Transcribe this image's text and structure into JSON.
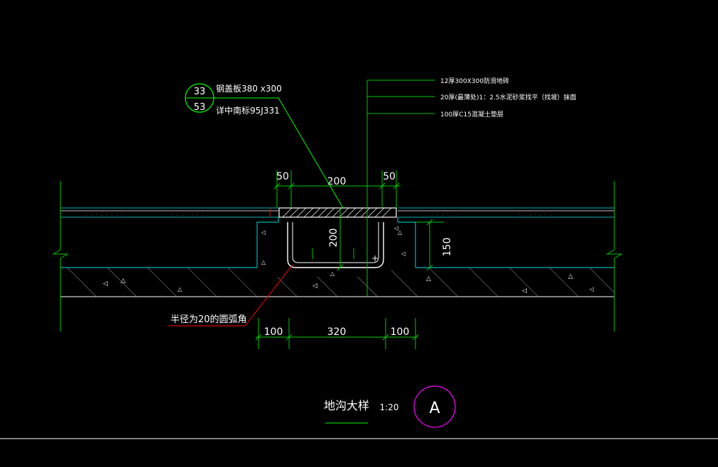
{
  "drawing": {
    "title": "地沟大样",
    "scale": "1:20",
    "detail_mark": "A",
    "callout": {
      "index_top": "33",
      "index_bottom": "53",
      "line1": "钢盖板380 x300",
      "line2": "详中南标95J331"
    },
    "layers": [
      "12厚300X300防滑地砖",
      "20厚(最薄处)1：2.5水泥砂浆找平（找坡）抹面",
      "100厚C15混凝土垫层"
    ],
    "radius_note": "半径为20的圆弧角",
    "dims": {
      "top_left": "50",
      "top_mid": "200",
      "top_right": "50",
      "bottom_left": "100",
      "bottom_mid": "320",
      "bottom_right": "100",
      "trench_depth": "200",
      "right_height": "150"
    },
    "colors": {
      "background": "#000000",
      "line": "#ffffff",
      "dimension": "#00c800",
      "slab": "#00b4b4",
      "callout": "#00ff00",
      "leader_red": "#ff0000",
      "detail_circle": "#ff00ff"
    }
  }
}
